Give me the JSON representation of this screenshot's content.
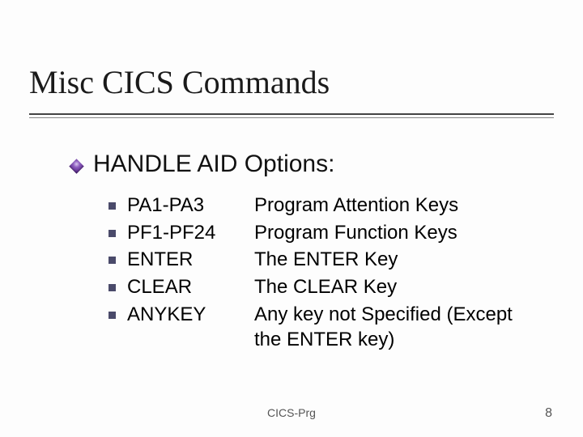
{
  "title": "Misc CICS Commands",
  "subtitle": "HANDLE AID Options:",
  "items": [
    {
      "key": "PA1-PA3",
      "desc": "Program Attention Keys"
    },
    {
      "key": "PF1-PF24",
      "desc": "Program Function Keys"
    },
    {
      "key": "ENTER",
      "desc": "The ENTER Key"
    },
    {
      "key": "CLEAR",
      "desc": "The CLEAR Key"
    },
    {
      "key": "ANYKEY",
      "desc": "Any key not Specified (Except the ENTER key)"
    }
  ],
  "footer": "CICS-Prg",
  "page": "8"
}
